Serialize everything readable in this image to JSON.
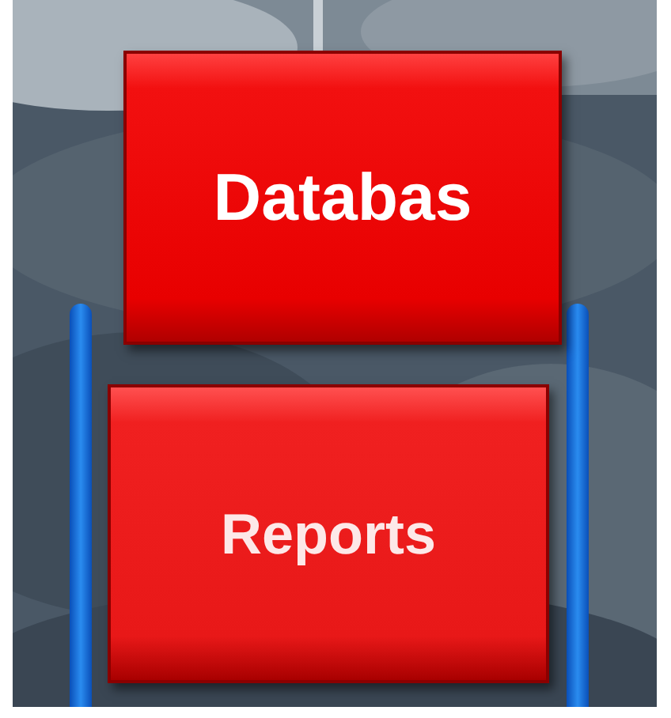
{
  "buttons": [
    {
      "label": "Databas"
    },
    {
      "label": "Reports"
    }
  ]
}
